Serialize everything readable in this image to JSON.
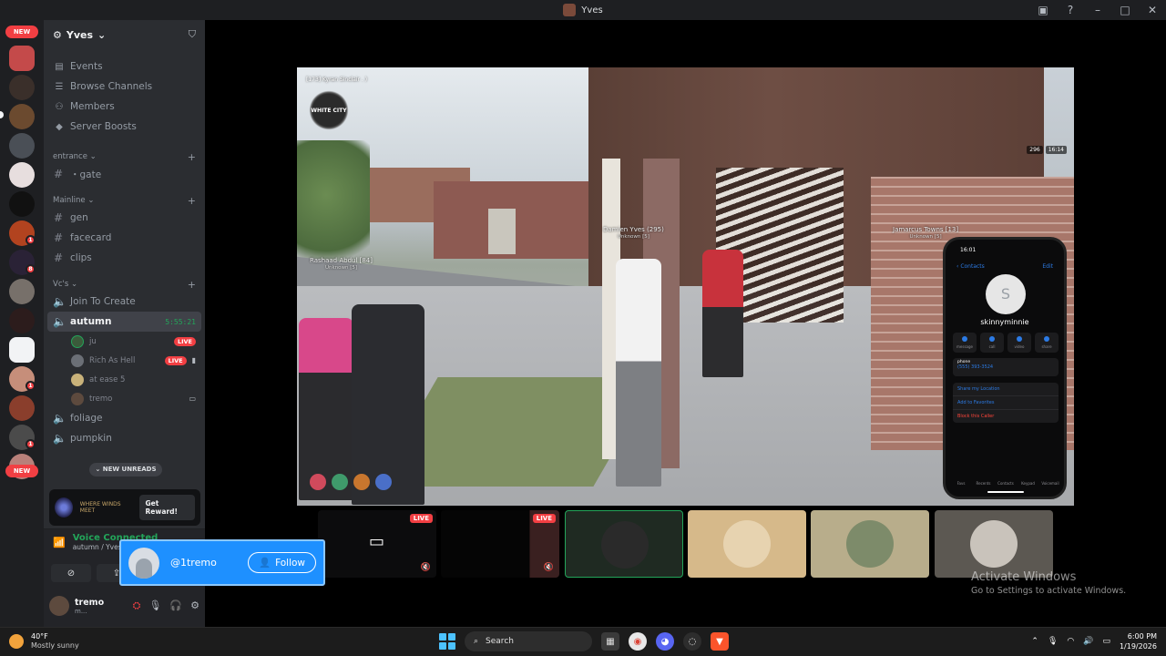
{
  "window": {
    "title": "Yves"
  },
  "server": {
    "name": "Yves"
  },
  "menu": [
    {
      "label": "Events",
      "icon": "calendar-icon"
    },
    {
      "label": "Browse Channels",
      "icon": "browse-icon"
    },
    {
      "label": "Members",
      "icon": "members-icon"
    },
    {
      "label": "Server Boosts",
      "icon": "boost-icon"
    }
  ],
  "categories": {
    "entrance": {
      "label": "entrance",
      "channels": [
        "・gate"
      ]
    },
    "mainline": {
      "label": "Mainline",
      "channels": [
        "gen",
        "facecard",
        "clips"
      ]
    },
    "vcs": {
      "label": "Vc's"
    }
  },
  "voice_channels": {
    "join": "Join To Create",
    "autumn": {
      "name": "autumn",
      "timer": "5:55:21"
    },
    "users": [
      {
        "name": "ju",
        "live": "LIVE"
      },
      {
        "name": "Rich As Hell",
        "live": "LIVE"
      },
      {
        "name": "at ease 5",
        "live": ""
      },
      {
        "name": "tremo",
        "live": ""
      }
    ],
    "foliage": "foliage",
    "pumpkin": "pumpkin"
  },
  "rail": {
    "new_top": "NEW",
    "new_bottom": "NEW",
    "badges": [
      "1",
      "8",
      "1",
      "1",
      "1"
    ]
  },
  "unreads": "NEW UNREADS",
  "promo": {
    "logo": "WHERE WINDS MEET",
    "button": "Get Reward!"
  },
  "voice": {
    "status": "Voice Connected",
    "channel": "autumn / Yves"
  },
  "user": {
    "name": "tremo",
    "status": "m..."
  },
  "follow": {
    "handle": "@1tremo",
    "button": "Follow"
  },
  "game": {
    "hud_tl": "[173] Kyran Sinclair . )",
    "logo": "WHITE CITY",
    "hud_id": [
      "296",
      "16:14"
    ],
    "tags": [
      {
        "name": "Rashaad Abdul [84]",
        "sub": "Unknown [5]"
      },
      {
        "name": "Damien Yves (295)",
        "sub": "Unknown [5]"
      },
      {
        "name": "Jamarcus Towns [13]",
        "sub": "Unknown [5]"
      }
    ]
  },
  "phone": {
    "time": "16:01",
    "back": "Contacts",
    "edit": "Edit",
    "initial": "S",
    "name": "skinnyminnie",
    "actions": [
      "message",
      "call",
      "video",
      "share"
    ],
    "phone_label": "phone",
    "phone_value": "(555) 393-3524",
    "options": [
      "Share my Location",
      "Add to Favorites",
      "Block this Caller"
    ],
    "tabs": [
      "Favs",
      "Recents",
      "Contacts",
      "Keypad",
      "Voicemail"
    ]
  },
  "tiles": {
    "live": "LIVE"
  },
  "activation": {
    "title": "Activate Windows",
    "subtitle": "Go to Settings to activate Windows."
  },
  "taskbar": {
    "temp": "40°F",
    "weather": "Mostly sunny",
    "search": "Search",
    "time": "6:00 PM",
    "date": "1/19/2026"
  }
}
